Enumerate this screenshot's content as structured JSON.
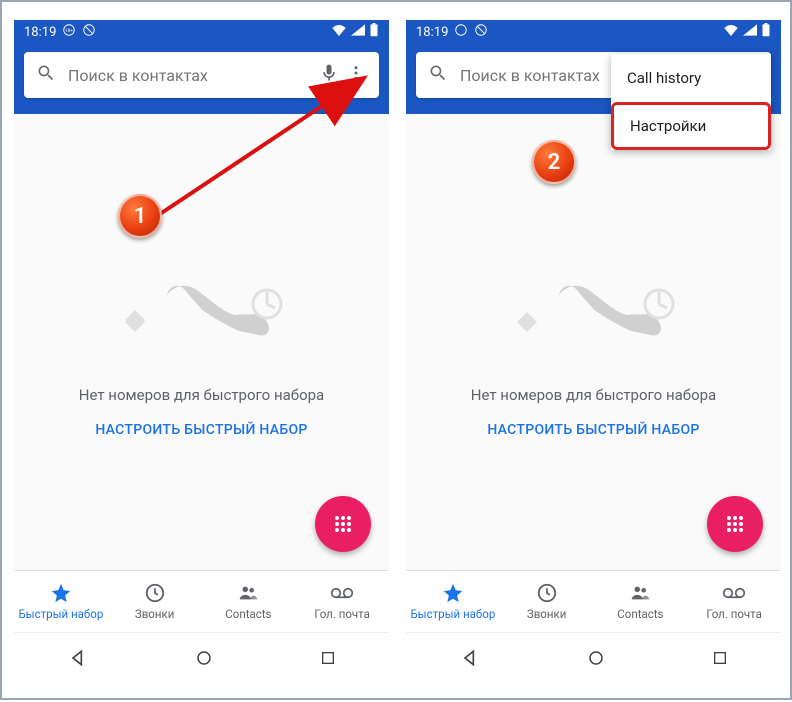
{
  "statusbar": {
    "time": "18:19"
  },
  "search": {
    "placeholder": "Поиск в контактах"
  },
  "empty": {
    "message": "Нет номеров для быстрого набора",
    "cta": "НАСТРОИТЬ БЫСТРЫЙ НАБОР"
  },
  "nav": {
    "speed": "Быстрый набор",
    "calls": "Звонки",
    "contacts": "Contacts",
    "voicemail": "Гол. почта"
  },
  "menu": {
    "call_history": "Call history",
    "settings": "Настройки"
  },
  "annotations": {
    "step1": "1",
    "step2": "2"
  }
}
